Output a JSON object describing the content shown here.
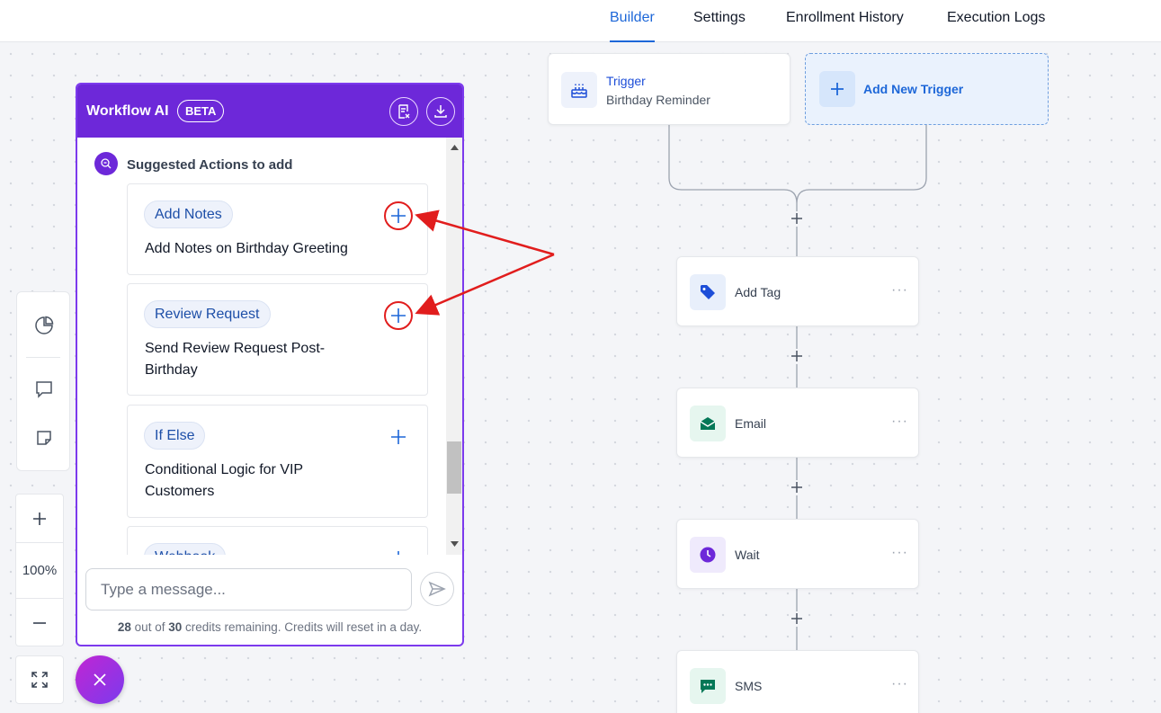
{
  "nav": {
    "tabs": [
      {
        "label": "Builder",
        "active": true
      },
      {
        "label": "Settings",
        "active": false
      },
      {
        "label": "Enrollment History",
        "active": false
      },
      {
        "label": "Execution Logs",
        "active": false
      }
    ]
  },
  "toolbar": {
    "icons": [
      "pie-chart-icon",
      "comment-icon",
      "note-icon"
    ],
    "zoom_level": "100%",
    "zoom_in_icon": "plus-icon",
    "zoom_out_icon": "minus-icon",
    "fit_icon": "expand-icon"
  },
  "ai_panel": {
    "title": "Workflow AI",
    "badge": "BETA",
    "section_title": "Suggested Actions to add",
    "suggestions": [
      {
        "tag": "Add Notes",
        "text": "Add Notes on Birthday Greeting",
        "highlighted": true
      },
      {
        "tag": "Review Request",
        "text": "Send Review Request Post-Birthday",
        "highlighted": true
      },
      {
        "tag": "If Else",
        "text": "Conditional Logic for VIP Customers",
        "highlighted": false
      },
      {
        "tag": "Webhook",
        "text": "",
        "highlighted": false
      }
    ],
    "input_placeholder": "Type a message...",
    "credits_used": "28",
    "credits_total": "30",
    "credits_prefix": "out of",
    "credits_suffix": "credits remaining. Credits will reset in a day."
  },
  "canvas": {
    "trigger": {
      "label": "Trigger",
      "name": "Birthday Reminder"
    },
    "add_trigger_label": "Add New Trigger",
    "actions": [
      {
        "label": "Add Tag",
        "icon": "tag-icon",
        "color": "#1d4ed8",
        "bg": "#e8effb"
      },
      {
        "label": "Email",
        "icon": "email-icon",
        "color": "#047857",
        "bg": "#e6f6ef"
      },
      {
        "label": "Wait",
        "icon": "clock-icon",
        "color": "#6d28d9",
        "bg": "#efeafc"
      },
      {
        "label": "SMS",
        "icon": "sms-icon",
        "color": "#047857",
        "bg": "#e6f6ef"
      }
    ],
    "node_menu": "···"
  },
  "colors": {
    "accent": "#1d67d8",
    "ai_purple": "#6d28d9",
    "annotation_red": "#e11d1d"
  }
}
